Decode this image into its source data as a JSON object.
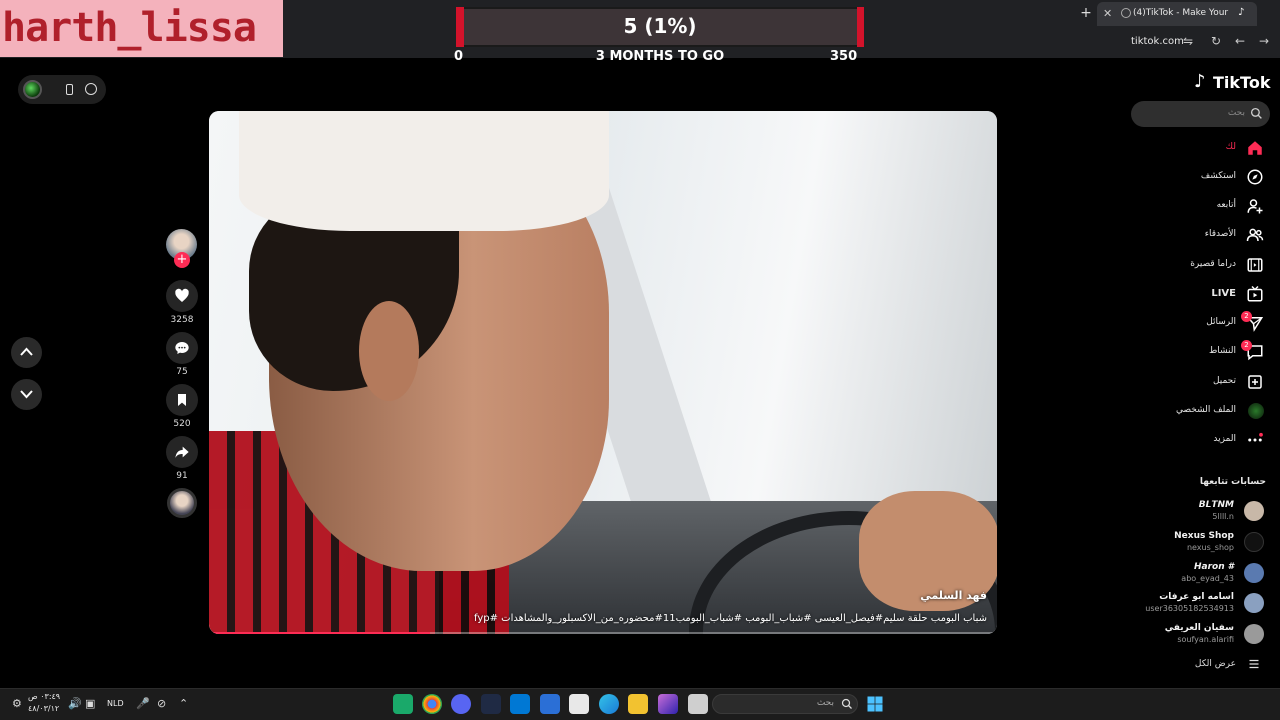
{
  "overlay": {
    "streamer_name": "harth_lissa",
    "goal": {
      "current_text": "5 (1%)",
      "min": "0",
      "label": "3 MONTHS TO GO",
      "max": "350",
      "progress": 0.01
    }
  },
  "browser": {
    "tab_title": "(4)TikTok - Make Your Day",
    "url": "tiktok.com"
  },
  "tiktok": {
    "logo": "TikTok",
    "search": {
      "placeholder": "بحث"
    },
    "nav": [
      {
        "label": "لك",
        "icon": "home-icon",
        "active": true
      },
      {
        "label": "استكشف",
        "icon": "compass-icon"
      },
      {
        "label": "أتابعه",
        "icon": "following-icon"
      },
      {
        "label": "الأصدقاء",
        "icon": "friends-icon"
      },
      {
        "label": "دراما قصيرة",
        "icon": "drama-icon"
      },
      {
        "label": "LIVE",
        "icon": "live-icon"
      },
      {
        "label": "الرسائل",
        "icon": "messages-icon",
        "badge": "2"
      },
      {
        "label": "النشاط",
        "icon": "activity-icon",
        "badge": "2"
      },
      {
        "label": "تحميل",
        "icon": "upload-icon"
      },
      {
        "label": "الملف الشخصي",
        "icon": "profile-icon"
      },
      {
        "label": "المزيد",
        "icon": "more-icon"
      }
    ],
    "following_title": "حسابات تتابعها",
    "following": [
      {
        "name": "𝘽𝙇𝙏𝙉𝙈",
        "user": "5llll.n",
        "color": "#c8b8a8"
      },
      {
        "name": "Nexus Shop",
        "user": "nexus_shop",
        "color": "#111111"
      },
      {
        "name": "Haron #",
        "user": "abo_eyad_43",
        "color": "#5a7ab0"
      },
      {
        "name": "اسامه ابو عرفات",
        "user": "user36305182534913",
        "color": "#8aa0c0"
      },
      {
        "name": "سفيان العريفي",
        "user": "soufyan.alarifi",
        "color": "#9a9a9a"
      }
    ],
    "show_all": "عرض الكل"
  },
  "video": {
    "author": "فهد السلمي",
    "caption": "شباب البومب حلقة سليم#فيصل_العيسى #شباب_البومب #شباب_البومب11#محضوره_من_الاكسبلور_والمشاهدات #fyp",
    "progress": 0.28,
    "likes": "3258",
    "comments": "75",
    "saves": "520",
    "shares": "91"
  },
  "taskbar": {
    "time": "٠٣:٤٩ ص",
    "date": "٤٨/٠٣/١٢",
    "language": "NLD",
    "search_placeholder": "بحث"
  },
  "colors": {
    "accent": "#fe2c55",
    "goal_red": "#d3132b",
    "bg": "#000000"
  }
}
